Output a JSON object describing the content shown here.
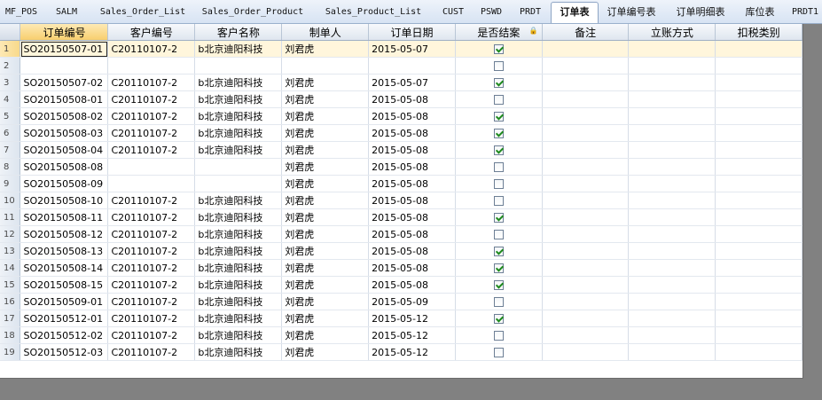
{
  "tabs": [
    {
      "label": "MF_POS",
      "active": false
    },
    {
      "label": "SALM",
      "active": false
    },
    {
      "label": "Sales_Order_List",
      "active": false
    },
    {
      "label": "Sales_Order_Product",
      "active": false
    },
    {
      "label": "Sales_Product_List",
      "active": false
    },
    {
      "label": "CUST",
      "active": false
    },
    {
      "label": "PSWD",
      "active": false
    },
    {
      "label": "PRDT",
      "active": false
    },
    {
      "label": "订单表",
      "active": true
    },
    {
      "label": "订单编号表",
      "active": false
    },
    {
      "label": "订单明细表",
      "active": false
    },
    {
      "label": "库位表",
      "active": false
    },
    {
      "label": "PRDT1",
      "active": false
    }
  ],
  "grid": {
    "columns": [
      "订单编号",
      "客户编号",
      "客户名称",
      "制单人",
      "订单日期",
      "是否结案",
      "备注",
      "立账方式",
      "扣税类别"
    ],
    "lock_icon": "lock-icon",
    "rows": [
      {
        "n": "1",
        "order": "SO20150507-01",
        "cust": "C20110107-2",
        "name": "b北京迪阳科技",
        "maker": "刘君虎",
        "date": "2015-05-07",
        "closed": true
      },
      {
        "n": "2",
        "order": "",
        "cust": "",
        "name": "",
        "maker": "",
        "date": "",
        "closed": false
      },
      {
        "n": "3",
        "order": "SO20150507-02",
        "cust": "C20110107-2",
        "name": "b北京迪阳科技",
        "maker": "刘君虎",
        "date": "2015-05-07",
        "closed": true
      },
      {
        "n": "4",
        "order": "SO20150508-01",
        "cust": "C20110107-2",
        "name": "b北京迪阳科技",
        "maker": "刘君虎",
        "date": "2015-05-08",
        "closed": false
      },
      {
        "n": "5",
        "order": "SO20150508-02",
        "cust": "C20110107-2",
        "name": "b北京迪阳科技",
        "maker": "刘君虎",
        "date": "2015-05-08",
        "closed": true
      },
      {
        "n": "6",
        "order": "SO20150508-03",
        "cust": "C20110107-2",
        "name": "b北京迪阳科技",
        "maker": "刘君虎",
        "date": "2015-05-08",
        "closed": true
      },
      {
        "n": "7",
        "order": "SO20150508-04",
        "cust": "C20110107-2",
        "name": "b北京迪阳科技",
        "maker": "刘君虎",
        "date": "2015-05-08",
        "closed": true
      },
      {
        "n": "8",
        "order": "SO20150508-08",
        "cust": "",
        "name": "",
        "maker": "刘君虎",
        "date": "2015-05-08",
        "closed": false
      },
      {
        "n": "9",
        "order": "SO20150508-09",
        "cust": "",
        "name": "",
        "maker": "刘君虎",
        "date": "2015-05-08",
        "closed": false
      },
      {
        "n": "10",
        "order": "SO20150508-10",
        "cust": "C20110107-2",
        "name": "b北京迪阳科技",
        "maker": "刘君虎",
        "date": "2015-05-08",
        "closed": false
      },
      {
        "n": "11",
        "order": "SO20150508-11",
        "cust": "C20110107-2",
        "name": "b北京迪阳科技",
        "maker": "刘君虎",
        "date": "2015-05-08",
        "closed": true
      },
      {
        "n": "12",
        "order": "SO20150508-12",
        "cust": "C20110107-2",
        "name": "b北京迪阳科技",
        "maker": "刘君虎",
        "date": "2015-05-08",
        "closed": false
      },
      {
        "n": "13",
        "order": "SO20150508-13",
        "cust": "C20110107-2",
        "name": "b北京迪阳科技",
        "maker": "刘君虎",
        "date": "2015-05-08",
        "closed": true
      },
      {
        "n": "14",
        "order": "SO20150508-14",
        "cust": "C20110107-2",
        "name": "b北京迪阳科技",
        "maker": "刘君虎",
        "date": "2015-05-08",
        "closed": true
      },
      {
        "n": "15",
        "order": "SO20150508-15",
        "cust": "C20110107-2",
        "name": "b北京迪阳科技",
        "maker": "刘君虎",
        "date": "2015-05-08",
        "closed": true
      },
      {
        "n": "16",
        "order": "SO20150509-01",
        "cust": "C20110107-2",
        "name": "b北京迪阳科技",
        "maker": "刘君虎",
        "date": "2015-05-09",
        "closed": false
      },
      {
        "n": "17",
        "order": "SO20150512-01",
        "cust": "C20110107-2",
        "name": "b北京迪阳科技",
        "maker": "刘君虎",
        "date": "2015-05-12",
        "closed": true
      },
      {
        "n": "18",
        "order": "SO20150512-02",
        "cust": "C20110107-2",
        "name": "b北京迪阳科技",
        "maker": "刘君虎",
        "date": "2015-05-12",
        "closed": false
      },
      {
        "n": "19",
        "order": "SO20150512-03",
        "cust": "C20110107-2",
        "name": "b北京迪阳科技",
        "maker": "刘君虎",
        "date": "2015-05-12",
        "closed": false
      }
    ]
  }
}
